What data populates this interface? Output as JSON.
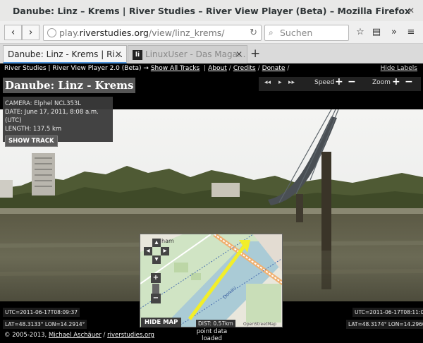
{
  "window": {
    "title": "Danube: Linz – Krems | River Studies – River View Player (Beta) – Mozilla Firefox"
  },
  "toolbar": {
    "url_prefix": "play.",
    "url_domain": "riverstudies.org",
    "url_path": "/view/linz_krems/",
    "search_placeholder": "Suchen"
  },
  "tabs": [
    {
      "label": "Danube: Linz - Krems | Ri..."
    },
    {
      "label": "LinuxUser - Das Maga..."
    }
  ],
  "topnav": {
    "brand": "River Studies | River View Player 2.0 (Beta)",
    "arrow": "→",
    "show_all_tracks": "Show All Tracks",
    "about": "About",
    "credits": "Credits",
    "donate": "Donate",
    "hide_labels": "Hide Labels"
  },
  "page_title": "Danube: Linz - Krems",
  "controls": {
    "speed_label": "Speed",
    "zoom_label": "Zoom"
  },
  "info": {
    "camera_label": "CAMERA:",
    "camera_value": "Elphel NCL353L",
    "date_label": "DATE:",
    "date_value": "June 17, 2011, 8:08 a.m. (UTC)",
    "length_label": "LENGTH:",
    "length_value": "137.5 km",
    "show_track_label": "SHOW TRACK"
  },
  "left_readout": {
    "utc": "UTC=2011-06-17T08:09:37",
    "coords": "LAT=48.3133° LON=14.2914°"
  },
  "right_readout": {
    "utc": "UTC=2011-06-17T08:11:04",
    "coords": "LAT=48.3174° LON=14.2960°"
  },
  "map": {
    "hide_map_label": "HIDE MAP",
    "distance": "DIST: 0.57km",
    "attribution": "OpenStreetMap",
    "place_label": "ham",
    "river_label": "Donau"
  },
  "status": {
    "line1": "point data",
    "line2": "loaded"
  },
  "footer": {
    "copyright": "© 2005-2013, ",
    "author": "Michael Aschäuer",
    "slash": " / ",
    "site": "riverstudies.org"
  }
}
